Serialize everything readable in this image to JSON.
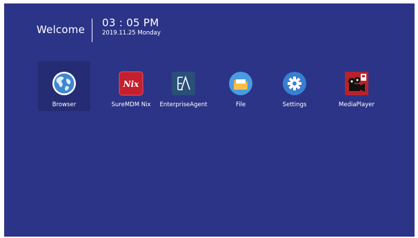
{
  "header": {
    "welcome": "Welcome",
    "time": "03 : 05 PM",
    "date": "2019.11.25 Monday"
  },
  "apps": [
    {
      "label": "Browser",
      "icon": "globe-icon"
    },
    {
      "label": "SureMDM Nix",
      "icon": "nix-icon",
      "icon_text": "Nix"
    },
    {
      "label": "EnterpriseAgent",
      "icon": "enterprise-agent-icon"
    },
    {
      "label": "File",
      "icon": "folder-icon"
    },
    {
      "label": "Settings",
      "icon": "gear-icon"
    },
    {
      "label": "MediaPlayer",
      "icon": "film-camera-icon"
    }
  ],
  "colors": {
    "background": "#2c3487",
    "selected_tile": "#262c74",
    "text": "#ffffff"
  }
}
